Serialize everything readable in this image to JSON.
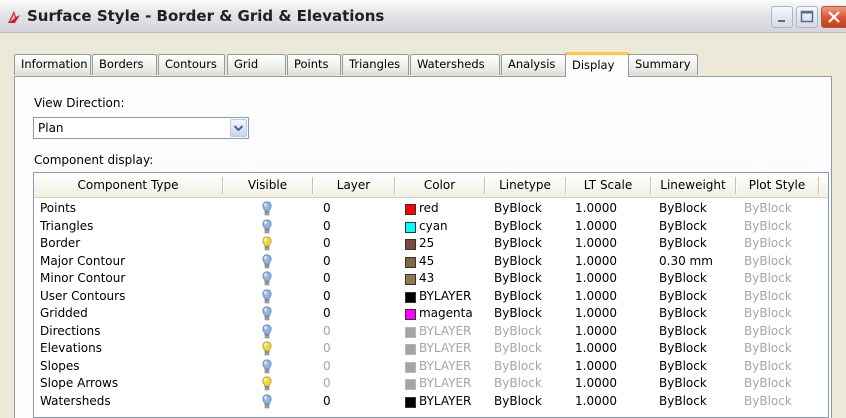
{
  "window": {
    "title": "Surface Style - Border & Grid & Elevations"
  },
  "tabs": [
    {
      "label": "Information"
    },
    {
      "label": "Borders"
    },
    {
      "label": "Contours"
    },
    {
      "label": "Grid"
    },
    {
      "label": "Points"
    },
    {
      "label": "Triangles"
    },
    {
      "label": "Watersheds"
    },
    {
      "label": "Analysis"
    },
    {
      "label": "Display"
    },
    {
      "label": "Summary"
    }
  ],
  "active_tab": "Display",
  "view_direction": {
    "label": "View Direction:",
    "value": "Plan"
  },
  "component_display": {
    "label": "Component display:",
    "columns": [
      "Component Type",
      "Visible",
      "Layer",
      "Color",
      "Linetype",
      "LT Scale",
      "Lineweight",
      "Plot Style"
    ],
    "rows": [
      {
        "type": "Points",
        "visible": "on",
        "layer": "0",
        "color": "red",
        "swatch": "#ff0000",
        "linetype": "ByBlock",
        "lt_scale": "1.0000",
        "lineweight": "ByBlock",
        "plot_style": "ByBlock",
        "dim": false
      },
      {
        "type": "Triangles",
        "visible": "on",
        "layer": "0",
        "color": "cyan",
        "swatch": "#00ffff",
        "linetype": "ByBlock",
        "lt_scale": "1.0000",
        "lineweight": "ByBlock",
        "plot_style": "ByBlock",
        "dim": false
      },
      {
        "type": "Border",
        "visible": "off",
        "layer": "0",
        "color": "25",
        "swatch": "#7f4a3f",
        "linetype": "ByBlock",
        "lt_scale": "1.0000",
        "lineweight": "ByBlock",
        "plot_style": "ByBlock",
        "dim": false
      },
      {
        "type": "Major Contour",
        "visible": "on",
        "layer": "0",
        "color": "45",
        "swatch": "#7f6a3f",
        "linetype": "ByBlock",
        "lt_scale": "1.0000",
        "lineweight": "0.30 mm",
        "plot_style": "ByBlock",
        "dim": false
      },
      {
        "type": "Minor Contour",
        "visible": "on",
        "layer": "0",
        "color": "43",
        "swatch": "#8f7a50",
        "linetype": "ByBlock",
        "lt_scale": "1.0000",
        "lineweight": "ByBlock",
        "plot_style": "ByBlock",
        "dim": false
      },
      {
        "type": "User Contours",
        "visible": "on",
        "layer": "0",
        "color": "BYLAYER",
        "swatch": "#000000",
        "linetype": "ByBlock",
        "lt_scale": "1.0000",
        "lineweight": "ByBlock",
        "plot_style": "ByBlock",
        "dim": false
      },
      {
        "type": "Gridded",
        "visible": "on",
        "layer": "0",
        "color": "magenta",
        "swatch": "#ff00ff",
        "linetype": "ByBlock",
        "lt_scale": "1.0000",
        "lineweight": "ByBlock",
        "plot_style": "ByBlock",
        "dim": false
      },
      {
        "type": "Directions",
        "visible": "on",
        "layer": "0",
        "color": "BYLAYER",
        "swatch": "#000000",
        "linetype": "ByBlock",
        "lt_scale": "1.0000",
        "lineweight": "ByBlock",
        "plot_style": "ByBlock",
        "dim": true
      },
      {
        "type": "Elevations",
        "visible": "off",
        "layer": "0",
        "color": "BYLAYER",
        "swatch": "#000000",
        "linetype": "ByBlock",
        "lt_scale": "1.0000",
        "lineweight": "ByBlock",
        "plot_style": "ByBlock",
        "dim": true
      },
      {
        "type": "Slopes",
        "visible": "on",
        "layer": "0",
        "color": "BYLAYER",
        "swatch": "#000000",
        "linetype": "ByBlock",
        "lt_scale": "1.0000",
        "lineweight": "ByBlock",
        "plot_style": "ByBlock",
        "dim": true
      },
      {
        "type": "Slope Arrows",
        "visible": "off",
        "layer": "0",
        "color": "BYLAYER",
        "swatch": "#000000",
        "linetype": "ByBlock",
        "lt_scale": "1.0000",
        "lineweight": "ByBlock",
        "plot_style": "ByBlock",
        "dim": true
      },
      {
        "type": "Watersheds",
        "visible": "on",
        "layer": "0",
        "color": "BYLAYER",
        "swatch": "#000000",
        "linetype": "ByBlock",
        "lt_scale": "1.0000",
        "lineweight": "ByBlock",
        "plot_style": "ByBlock",
        "dim": false
      }
    ]
  },
  "icons": {
    "app": "civil3d-style-icon",
    "visible_on": "lightbulb-on-icon",
    "visible_off": "lightbulb-off-icon",
    "combo": "chevron-down-icon"
  },
  "colors": {
    "active_tab_accent": "#ffc83c",
    "bulb_on": "#8fb5e0",
    "bulb_off": "#f0d640",
    "dim_text": "#a7a69d"
  }
}
